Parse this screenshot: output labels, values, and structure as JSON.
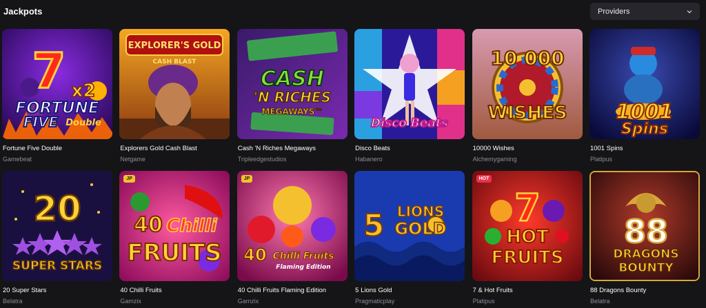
{
  "header": {
    "title": "Jackpots",
    "providers_label": "Providers",
    "providers_icon": "chevron-down-icon"
  },
  "games": [
    {
      "name": "Fortune Five Double",
      "provider": "Gamebeat"
    },
    {
      "name": "Explorers Gold Cash Blast",
      "provider": "Netgame"
    },
    {
      "name": "Cash 'N Riches Megaways",
      "provider": "Tripleedgestudios"
    },
    {
      "name": "Disco Beats",
      "provider": "Habanero"
    },
    {
      "name": "10000 Wishes",
      "provider": "Alchemygaming"
    },
    {
      "name": "1001 Spins",
      "provider": "Platipus"
    },
    {
      "name": "20 Super Stars",
      "provider": "Belatra"
    },
    {
      "name": "40 Chilli Fruits",
      "provider": "Gamzix",
      "badge": "JP"
    },
    {
      "name": "40 Chilli Fruits Flaming Edition",
      "provider": "Gamzix",
      "badge": "JP"
    },
    {
      "name": "5 Lions Gold",
      "provider": "Pragmaticplay"
    },
    {
      "name": "7 & Hot Fruits",
      "provider": "Platipus",
      "badge": "HOT"
    },
    {
      "name": "88 Dragons Bounty",
      "provider": "Belatra"
    }
  ],
  "thumb_text": {
    "fortune_five_top": "7",
    "fortune_five_mult": "x2",
    "fortune_five_line1": "FORTUNE",
    "fortune_five_line2": "FIVE",
    "fortune_five_line3": "Double",
    "explorers_line1": "EXPLORER'S GOLD",
    "explorers_line2": "CASH BLAST",
    "cash_line1": "CASH",
    "cash_line2": "'N RICHES",
    "cash_line3": "MEGAWAYS™",
    "disco_line1": "Disco Beats",
    "wishes_line1": "10 000",
    "wishes_line2": "WISHES",
    "spins_line1": "1001",
    "spins_line2": "Spins",
    "stars_line1": "20",
    "stars_line2": "SUPER STARS",
    "chilli_line1": "40",
    "chilli_line2": "Chilli",
    "chilli_line3": "FRUITS",
    "flaming_line1": "40",
    "flaming_line2": "Chilli Fruits",
    "flaming_line3": "Flaming Edition",
    "lions_line1": "5",
    "lions_line2": "LIONS",
    "lions_line3": "GOLD",
    "hot_line1": "7",
    "hot_line2": "HOT",
    "hot_line3": "FRUITS",
    "dragons_line1": "88",
    "dragons_line2": "DRAGONS",
    "dragons_line3": "BOUNTY"
  },
  "colors": {
    "background": "#151518",
    "dropdown_bg": "#26262c",
    "provider_text": "#8c8c96",
    "badge_jp": "#f2c230",
    "badge_hot": "#e8324a"
  }
}
